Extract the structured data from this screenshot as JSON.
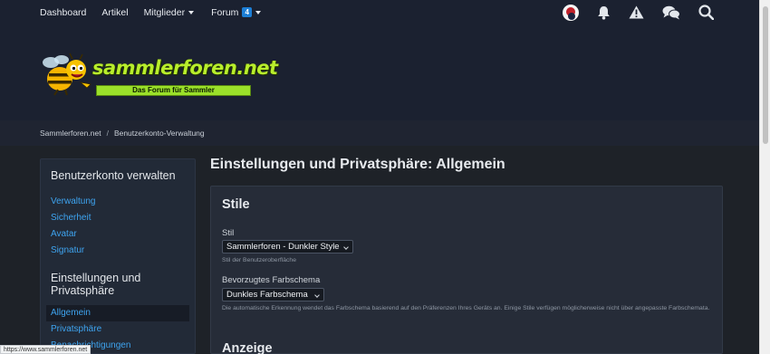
{
  "nav": {
    "items": [
      {
        "label": "Dashboard"
      },
      {
        "label": "Artikel"
      },
      {
        "label": "Mitglieder"
      },
      {
        "label": "Forum",
        "badge": "4"
      }
    ]
  },
  "logo": {
    "text": "sammlerforen.net",
    "tagline": "Das Forum für Sammler"
  },
  "breadcrumb": {
    "items": [
      "Sammlerforen.net",
      "Benutzerkonto-Verwaltung"
    ],
    "separator": "/"
  },
  "sidebar": {
    "heading1": "Benutzerkonto verwalten",
    "links1": [
      "Verwaltung",
      "Sicherheit",
      "Avatar",
      "Signatur"
    ],
    "heading2": "Einstellungen und Privatsphäre",
    "active": "Allgemein",
    "links2": [
      "Privatsphäre",
      "Benachrichtigungen"
    ]
  },
  "main": {
    "title": "Einstellungen und Privatsphäre: Allgemein",
    "section1": "Stile",
    "style_label": "Stil",
    "style_value": "Sammlerforen - Dunkler Style",
    "style_hint": "Stil der Benutzeroberfläche",
    "scheme_label": "Bevorzugtes Farbschema",
    "scheme_value": "Dunkles Farbschema",
    "scheme_hint": "Die automatische Erkennung wendet das Farbschema basierend auf den Präferenzen Ihres Geräts an. Einige Stile verfügen möglicherweise nicht über angepasste Farbschemata.",
    "section2": "Anzeige"
  },
  "status_url": "https://www.sammlerforen.net",
  "colors": {
    "accent_link": "#3ea4f0",
    "badge": "#1d7fd6",
    "logo_green": "#9be02a"
  }
}
